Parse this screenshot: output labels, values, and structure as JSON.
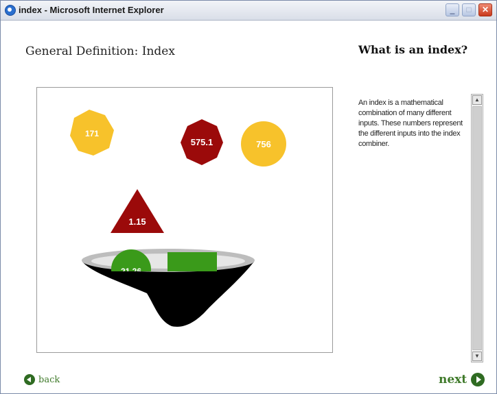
{
  "window": {
    "title": "index - Microsoft Internet Explorer",
    "minimize_glyph": "_",
    "maximize_glyph": "□",
    "close_glyph": "✕"
  },
  "page": {
    "heading": "General Definition: Index",
    "side_heading": "What is an index?",
    "description": "An index is a mathematical combination of many different inputs. These numbers represent the different inputs into the index combiner."
  },
  "shapes": {
    "yellow_octagon": {
      "label": "171",
      "color": "#f7c22b"
    },
    "red_octagon": {
      "label": "575.1",
      "color": "#9b0a0a"
    },
    "yellow_circle": {
      "label": "756",
      "color": "#f7c22b"
    },
    "red_triangle": {
      "label": "1.15",
      "color": "#9b0a0a"
    },
    "green_circle": {
      "label": "21.26",
      "color": "#3a9a1a"
    },
    "green_square": {
      "color": "#3a9a1a"
    },
    "bowl": {
      "rim_color": "#bdbdbd",
      "body_color": "#000000"
    }
  },
  "nav": {
    "back_label": "back",
    "next_label": "next"
  }
}
